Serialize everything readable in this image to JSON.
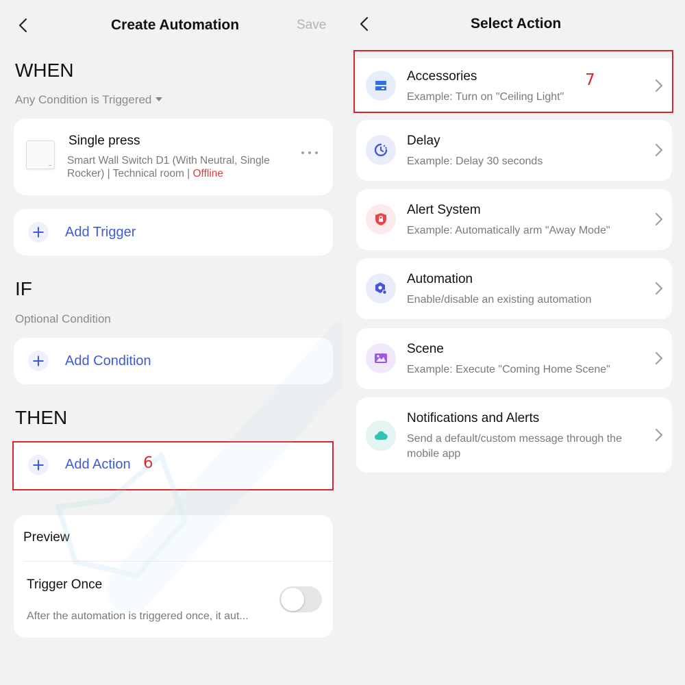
{
  "left": {
    "header": {
      "title": "Create Automation",
      "save_label": "Save"
    },
    "when": {
      "title": "WHEN",
      "condition_mode": "Any Condition is Triggered",
      "trigger": {
        "name": "Single press",
        "device_line1": "Smart Wall Switch D1 (With Neutral, Single",
        "device_line2": "Rocker) | Technical room | ",
        "status": "Offline"
      },
      "add_trigger_label": "Add Trigger"
    },
    "if": {
      "title": "IF",
      "subtitle": "Optional Condition",
      "add_condition_label": "Add Condition"
    },
    "then": {
      "title": "THEN",
      "add_action_label": "Add Action",
      "annotation": "6"
    },
    "preview": {
      "label": "Preview",
      "trigger_once_label": "Trigger Once",
      "trigger_once_desc": "After the automation is triggered once, it aut...",
      "trigger_once_enabled": false
    }
  },
  "right": {
    "header": {
      "title": "Select Action"
    },
    "annotation": "7",
    "actions": [
      {
        "title": "Accessories",
        "desc": "Example: Turn on \"Ceiling Light\"",
        "icon": "accessory-icon",
        "icon_bg": "#e6eefb",
        "icon_color": "#2f6fe0"
      },
      {
        "title": "Delay",
        "desc": "Example: Delay 30 seconds",
        "icon": "delay-clock-icon",
        "icon_bg": "#e9ecfb",
        "icon_color": "#3f5ad8"
      },
      {
        "title": "Alert System",
        "desc": "Example: Automatically arm \"Away Mode\"",
        "icon": "shield-lock-icon",
        "icon_bg": "#fdeaea",
        "icon_color": "#e8454a"
      },
      {
        "title": "Automation",
        "desc": "Enable/disable an existing automation",
        "icon": "automation-hexagon-icon",
        "icon_bg": "#e9ecfb",
        "icon_color": "#4a55d8"
      },
      {
        "title": "Scene",
        "desc": "Example: Execute \"Coming Home Scene\"",
        "icon": "scene-image-icon",
        "icon_bg": "#f1e8fb",
        "icon_color": "#9b5be0"
      },
      {
        "title": "Notifications and Alerts",
        "desc": "Send a default/custom message through the mobile app",
        "icon": "cloud-icon",
        "icon_bg": "#e3f6f4",
        "icon_color": "#2ec4b2"
      }
    ]
  },
  "colors": {
    "accent": "#3f5ad8",
    "annotation": "#d6262d",
    "offline": "#e53935"
  }
}
